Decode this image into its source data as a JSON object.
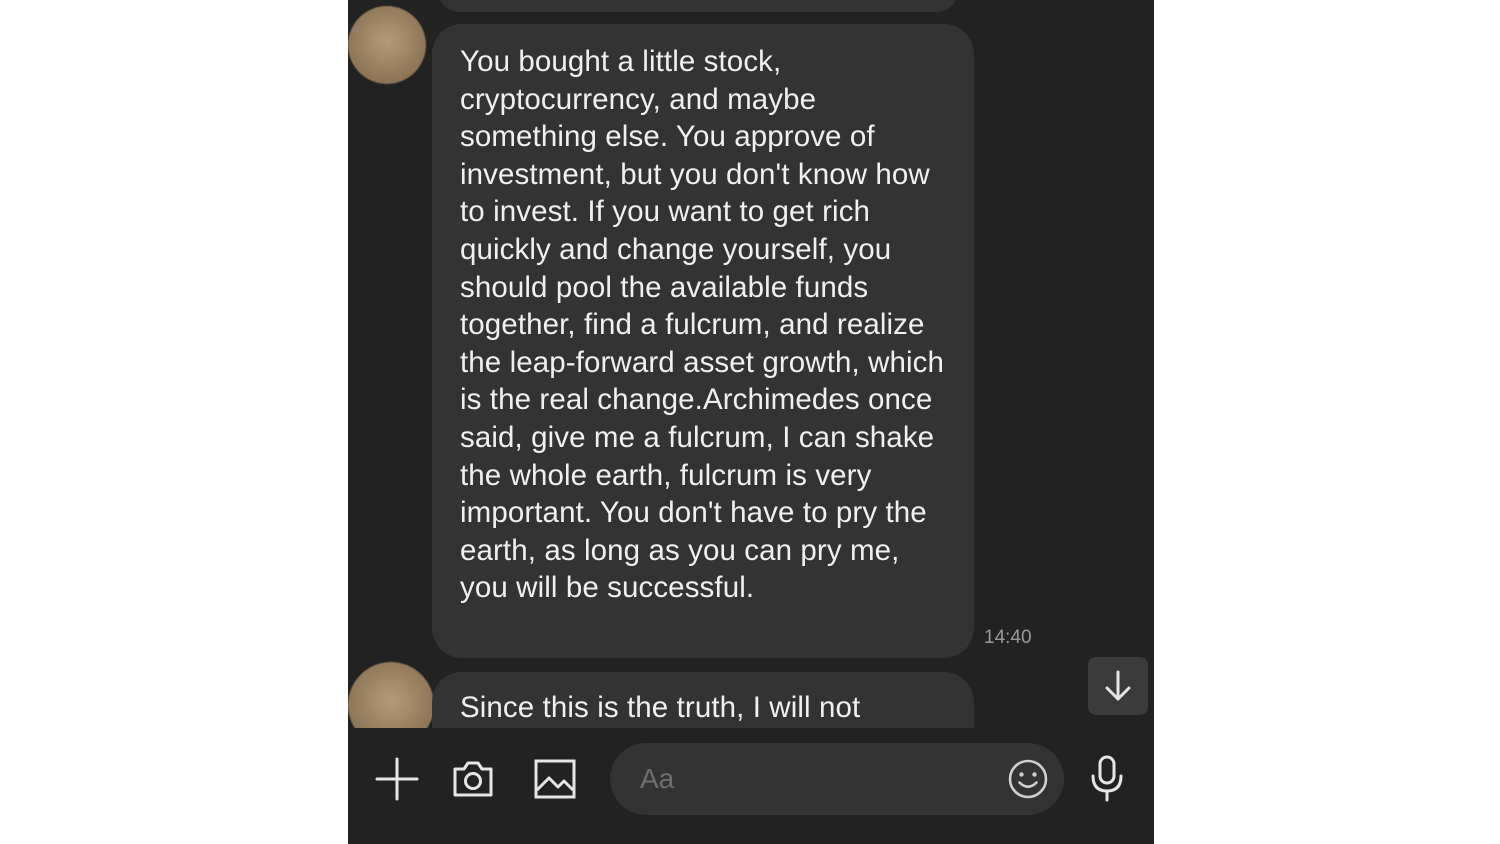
{
  "messages": [
    {
      "text": "You bought a little stock, cryptocurrency, and maybe something else. You approve of investment, but you don't know how to invest. If you want to get rich quickly and change yourself, you should pool the available funds together, find a fulcrum, and realize the leap-forward asset growth, which is the real change.Archimedes once said, give me a fulcrum, I can shake the whole earth, fulcrum is very important. You don't have to pry the earth, as long as you can pry me, you will be successful.",
      "time": "14:40"
    },
    {
      "text": "Since this is the truth, I will not"
    }
  ],
  "composer": {
    "placeholder": "Aa",
    "icons": [
      "plus-icon",
      "camera-icon",
      "image-icon",
      "emoji-icon",
      "microphone-icon"
    ]
  },
  "scroll_button": {
    "icon": "arrow-down-icon"
  },
  "colors": {
    "background": "#222222",
    "bubble": "#333333",
    "text": "#f0f0f0",
    "timestamp": "#9a9a9a"
  }
}
